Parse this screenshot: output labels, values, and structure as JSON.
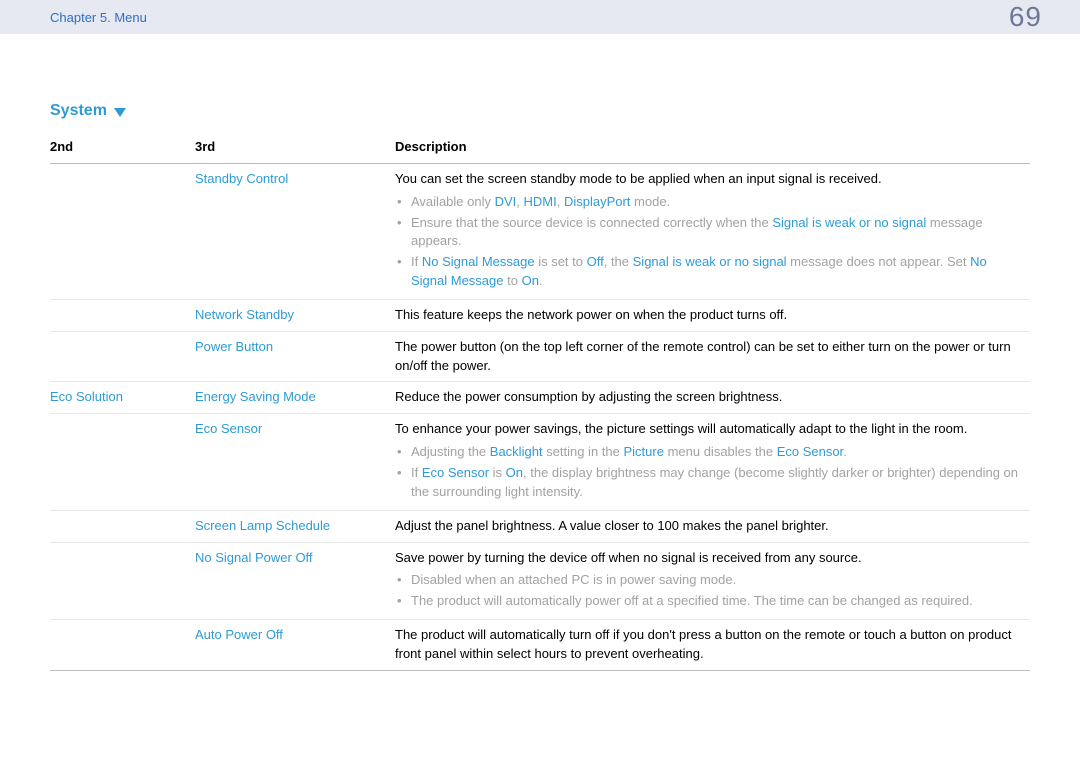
{
  "header": {
    "chapter": "Chapter 5.  Menu",
    "page": "69"
  },
  "section": {
    "title": "System"
  },
  "table": {
    "headers": {
      "c2": "2nd",
      "c3": "3rd",
      "desc": "Description"
    }
  },
  "rows": {
    "standby": {
      "third": "Standby Control",
      "desc": "You can set the screen standby mode to be applied when an input signal is received.",
      "b1_pre": "Available only ",
      "b1_dvi": "DVI",
      "b1_c1": ", ",
      "b1_hdmi": "HDMI",
      "b1_c2": ", ",
      "b1_dp": "DisplayPort",
      "b1_post": " mode.",
      "b2_pre": "Ensure that the source device is connected correctly when the ",
      "b2_sig": "Signal is weak or no signal",
      "b2_post": " message appears.",
      "b3_p1": "If ",
      "b3_nsm": "No Signal Message",
      "b3_p2": " is set to ",
      "b3_off": "Off",
      "b3_p3": ", the ",
      "b3_sig": "Signal is weak or no signal",
      "b3_p4": " message does not appear. Set ",
      "b3_nsm2": "No Signal Message",
      "b3_p5": " to ",
      "b3_on": "On",
      "b3_p6": "."
    },
    "network": {
      "third": "Network Standby",
      "desc": "This feature keeps the network power on when the product turns off."
    },
    "power": {
      "third": "Power Button",
      "desc": "The power button (on the top left corner of the remote control) can be set to either turn on the power or turn on/off the power."
    },
    "eco": {
      "second": "Eco Solution"
    },
    "esm": {
      "third": "Energy Saving Mode",
      "desc": "Reduce the power consumption by adjusting the screen brightness."
    },
    "ecosensor": {
      "third": "Eco Sensor",
      "desc": "To enhance your power savings, the picture settings will automatically adapt to the light in the room.",
      "b1_p1": "Adjusting the ",
      "b1_bl": "Backlight",
      "b1_p2": " setting in the ",
      "b1_pic": "Picture",
      "b1_p3": " menu disables the ",
      "b1_es": "Eco Sensor",
      "b1_p4": ".",
      "b2_p1": "If ",
      "b2_es": "Eco Sensor",
      "b2_p2": " is ",
      "b2_on": "On",
      "b2_p3": ", the display brightness may change (become slightly darker or brighter) depending on the surrounding light intensity."
    },
    "lamp": {
      "third": "Screen Lamp Schedule",
      "desc": "Adjust the panel brightness. A value closer to 100 makes the panel brighter."
    },
    "nosig": {
      "third": "No Signal Power Off",
      "desc": "Save power by turning the device off when no signal is received from any source.",
      "b1": "Disabled when an attached PC is in power saving mode.",
      "b2": "The product will automatically power off at a specified time. The time can be changed as required."
    },
    "auto": {
      "third": "Auto Power Off",
      "desc": "The product will automatically turn off if you don't press a button on the remote or touch a button on product front panel within select hours to prevent overheating."
    }
  }
}
